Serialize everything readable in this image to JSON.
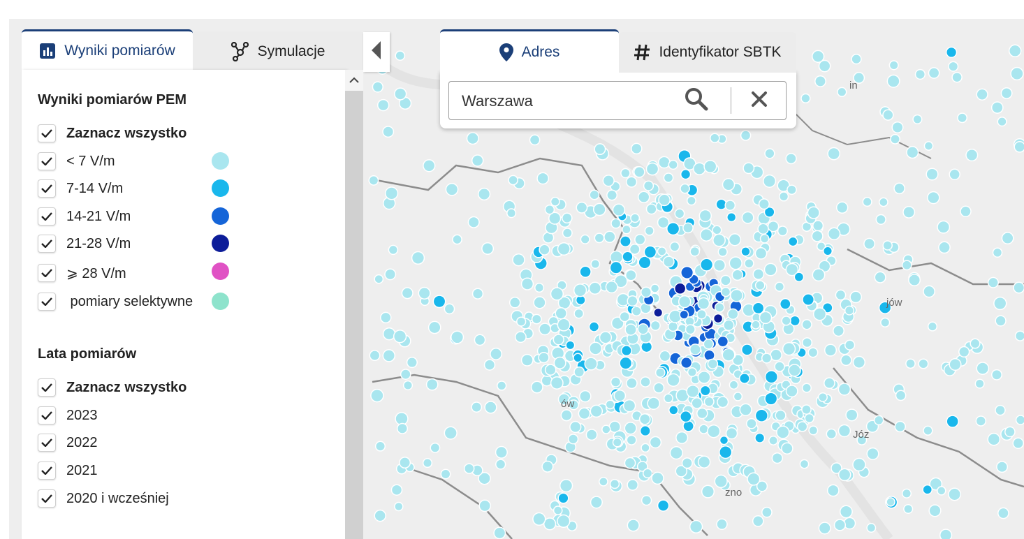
{
  "left_tabs": [
    {
      "label": "Wyniki pomiarów",
      "icon": "bar-chart-icon",
      "active": true
    },
    {
      "label": "Symulacje",
      "icon": "hub-network-icon",
      "active": false
    }
  ],
  "right_tabs": [
    {
      "label": "Adres",
      "icon": "map-pin-icon",
      "active": true
    },
    {
      "label": "Identyfikator SBTK",
      "icon": "hash-icon",
      "active": false
    }
  ],
  "search": {
    "value": "Warszawa",
    "placeholder": ""
  },
  "measurements": {
    "title": "Wyniki pomiarów PEM",
    "select_all": "Zaznacz wszystko",
    "items": [
      {
        "label": "< 7 V/m",
        "color": "#a9e6ef",
        "checked": true
      },
      {
        "label": "7-14 V/m",
        "color": "#19b7ec",
        "checked": true
      },
      {
        "label": "14-21 V/m",
        "color": "#1565d8",
        "checked": true
      },
      {
        "label": "21-28 V/m",
        "color": "#0d1d99",
        "checked": true
      },
      {
        "label": "⩾ 28 V/m",
        "color": "#e052c4",
        "checked": true
      },
      {
        "label": " pomiary selektywne",
        "color": "#8ee3cc",
        "checked": true
      }
    ]
  },
  "years": {
    "title": "Lata pomiarów",
    "select_all": "Zaznacz wszystko",
    "items": [
      {
        "label": "2023",
        "checked": true
      },
      {
        "label": "2022",
        "checked": true
      },
      {
        "label": "2021",
        "checked": true
      },
      {
        "label": "2020 i wcześniej",
        "checked": true
      }
    ]
  },
  "map": {
    "background_color": "#eeeeee",
    "river_color": "#e3e3e3",
    "boundary_color": "#8c8c8c",
    "dot_palette": [
      "#a9e6ef",
      "#19b7ec",
      "#1565d8",
      "#0d1d99"
    ],
    "place_labels": [
      "in",
      "jów",
      "Józ",
      "zno",
      "ów"
    ]
  }
}
